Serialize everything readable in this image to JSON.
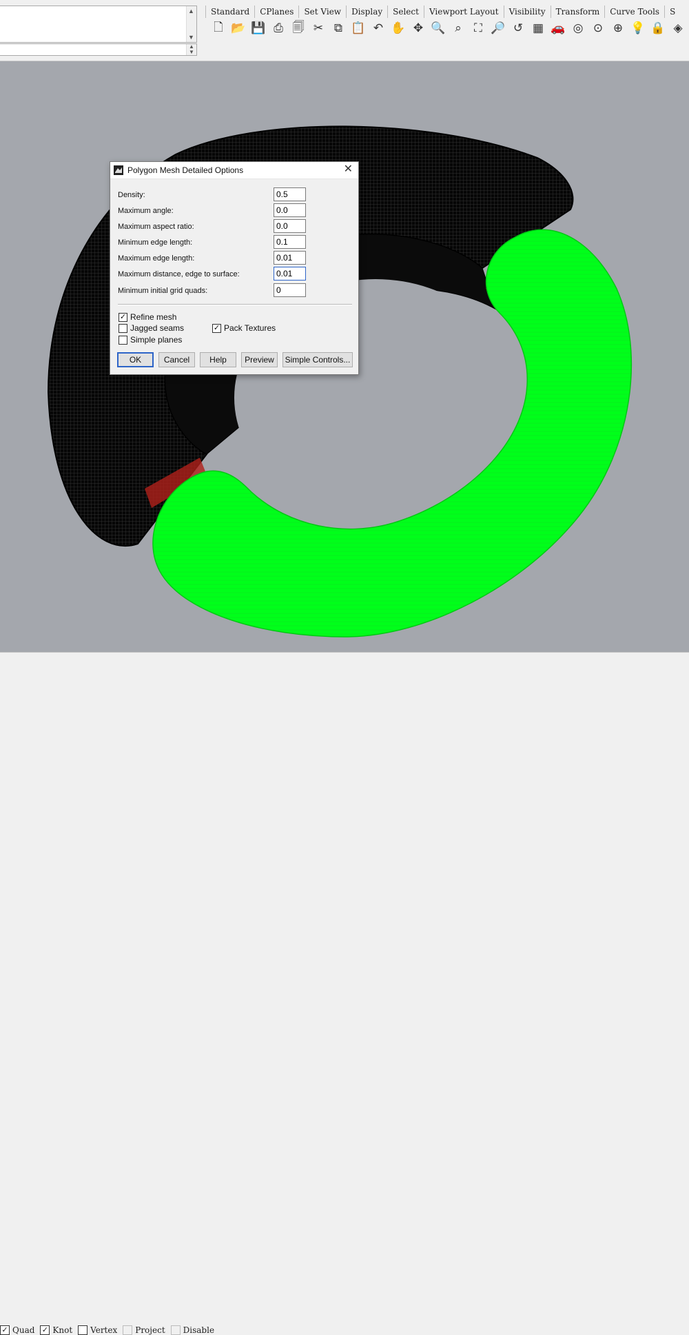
{
  "toolbar_tabs": [
    "Standard",
    "CPlanes",
    "Set View",
    "Display",
    "Select",
    "Viewport Layout",
    "Visibility",
    "Transform",
    "Curve Tools",
    "S"
  ],
  "toolbar_icons": [
    {
      "name": "new-icon",
      "glyph": "🗋"
    },
    {
      "name": "open-icon",
      "glyph": "📂"
    },
    {
      "name": "save-icon",
      "glyph": "💾"
    },
    {
      "name": "print-icon",
      "glyph": "⎙"
    },
    {
      "name": "import-icon",
      "glyph": "🗐"
    },
    {
      "name": "cut-icon",
      "glyph": "✂"
    },
    {
      "name": "copy-icon",
      "glyph": "⧉"
    },
    {
      "name": "paste-icon",
      "glyph": "📋"
    },
    {
      "name": "undo-icon",
      "glyph": "↶"
    },
    {
      "name": "pan-icon",
      "glyph": "✋"
    },
    {
      "name": "rotate-view-icon",
      "glyph": "✥"
    },
    {
      "name": "zoom-icon",
      "glyph": "🔍"
    },
    {
      "name": "zoom-window-icon",
      "glyph": "⌕"
    },
    {
      "name": "zoom-extents-icon",
      "glyph": "⛶"
    },
    {
      "name": "zoom-selected-icon",
      "glyph": "🔎"
    },
    {
      "name": "undo-view-icon",
      "glyph": "↺"
    },
    {
      "name": "four-viewports-icon",
      "glyph": "▦"
    },
    {
      "name": "car-icon",
      "glyph": "🚗"
    },
    {
      "name": "osnap-icon",
      "glyph": "◎"
    },
    {
      "name": "cplane-icon",
      "glyph": "⊙"
    },
    {
      "name": "gumball-icon",
      "glyph": "⊕"
    },
    {
      "name": "light-icon",
      "glyph": "💡"
    },
    {
      "name": "lock-icon",
      "glyph": "🔒"
    },
    {
      "name": "material-icon",
      "glyph": "◈"
    },
    {
      "name": "render-icon",
      "glyph": "◉"
    }
  ],
  "dialog": {
    "title": "Polygon Mesh Detailed Options",
    "close_glyph": "✕",
    "fields": [
      {
        "label": "Density:",
        "value": "0.5"
      },
      {
        "label": "Maximum angle:",
        "value": "0.0"
      },
      {
        "label": "Maximum aspect ratio:",
        "value": "0.0"
      },
      {
        "label": "Minimum edge length:",
        "value": "0.1"
      },
      {
        "label": "Maximum edge length:",
        "value": "0.01"
      },
      {
        "label": "Maximum distance, edge to surface:",
        "value": "0.01"
      },
      {
        "label": "Minimum initial grid quads:",
        "value": "0"
      }
    ],
    "checkboxes": {
      "refine_mesh": {
        "label": "Refine mesh",
        "checked": true
      },
      "jagged_seams": {
        "label": "Jagged seams",
        "checked": false
      },
      "simple_planes": {
        "label": "Simple planes",
        "checked": false
      },
      "pack_textures": {
        "label": "Pack Textures",
        "checked": true
      }
    },
    "buttons": {
      "ok": "OK",
      "cancel": "Cancel",
      "help": "Help",
      "preview": "Preview",
      "simple_controls": "Simple Controls..."
    }
  },
  "osnaps": [
    {
      "label": "Quad",
      "checked": true
    },
    {
      "label": "Knot",
      "checked": true
    },
    {
      "label": "Vertex",
      "checked": false
    },
    {
      "label": "Project",
      "checked": false,
      "disabled": true
    },
    {
      "label": "Disable",
      "checked": false,
      "disabled": true
    }
  ],
  "colors": {
    "viewport_bg": "#a4a7ad",
    "mesh_green": "#00ff1a",
    "mesh_black": "#080808",
    "seam_red": "#b0201a",
    "focus_blue": "#2d64c8"
  }
}
